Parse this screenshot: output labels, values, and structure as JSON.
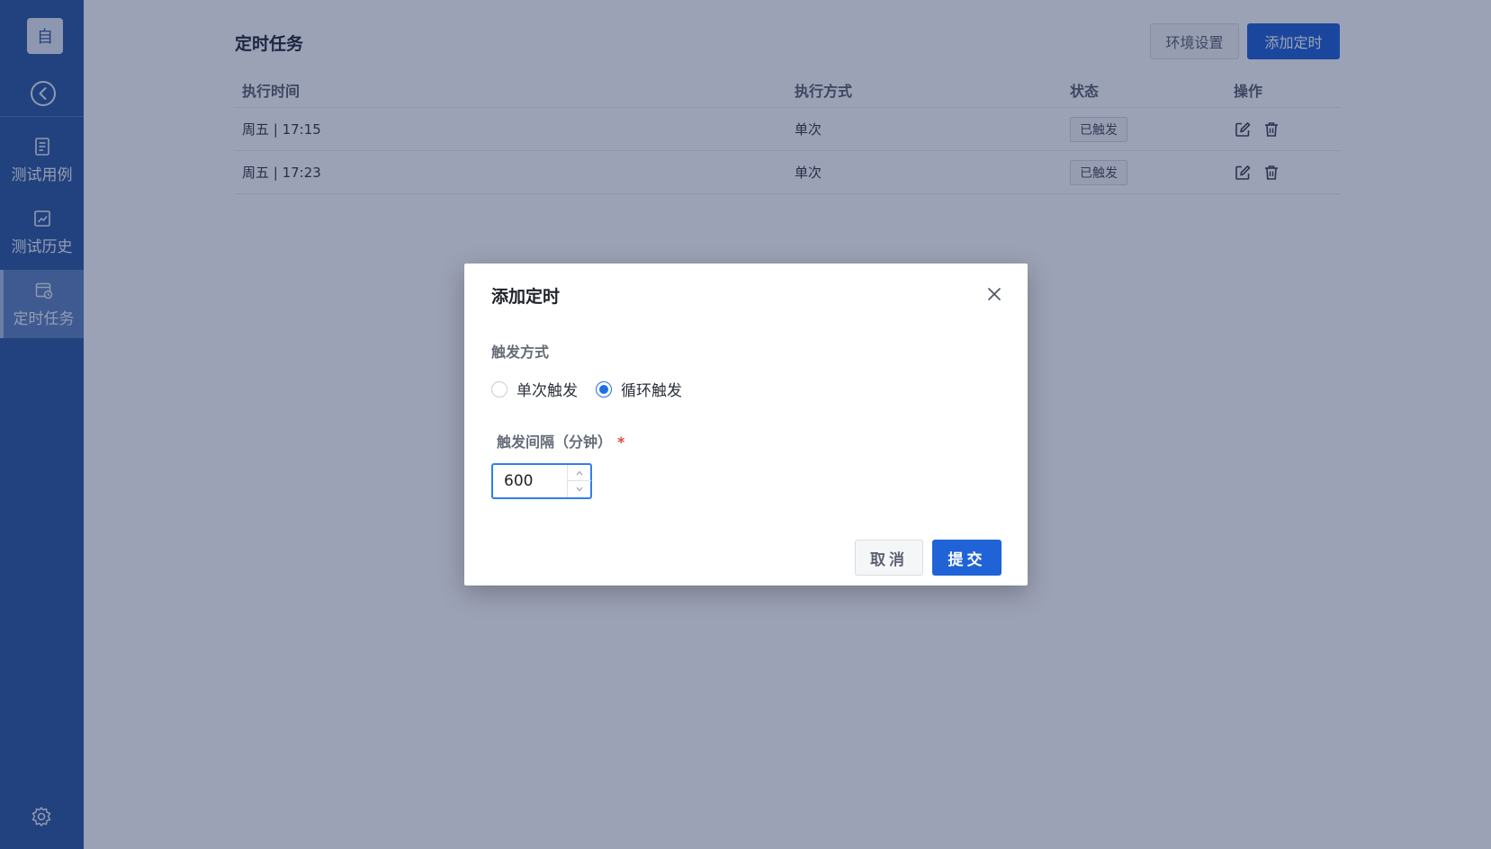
{
  "colors": {
    "sidebar": "#2c5aa0",
    "primary": "#1f63d6",
    "mask": "rgba(18,34,78,0.42)",
    "required": "#e24a4a"
  },
  "sidebar": {
    "logo_text": "自",
    "back_icon": "chevron-left-circle-icon",
    "items": [
      {
        "label": "测试用例",
        "icon": "document-list-icon",
        "active": false
      },
      {
        "label": "测试历史",
        "icon": "chart-edit-icon",
        "active": false
      },
      {
        "label": "定时任务",
        "icon": "calendar-clock-icon",
        "active": true
      }
    ],
    "settings_icon": "gear-icon"
  },
  "main": {
    "title": "定时任务",
    "env_button": "环境设置",
    "add_button": "添加定时",
    "table": {
      "headers": [
        "执行时间",
        "执行方式",
        "状态",
        "操作"
      ],
      "rows": [
        {
          "time": "周五 | 17:15",
          "mode": "单次",
          "status": "已触发"
        },
        {
          "time": "周五 | 17:23",
          "mode": "单次",
          "status": "已触发"
        }
      ]
    }
  },
  "dialog": {
    "title": "添加定时",
    "trigger_label": "触发方式",
    "options": [
      "单次触发",
      "循环触发"
    ],
    "selected_option": "循环触发",
    "interval_label": "触发间隔（分钟）",
    "required_mark": "*",
    "interval_value": "600",
    "cancel_button": "取消",
    "submit_button": "提交"
  }
}
